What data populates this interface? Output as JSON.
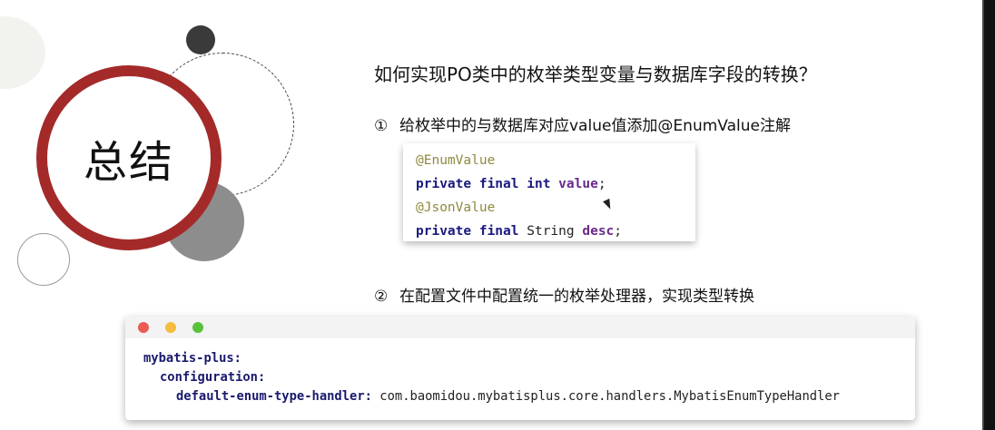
{
  "slide": {
    "ring_label": "总结",
    "title": "如何实现PO类中的枚举类型变量与数据库字段的转换？",
    "steps": [
      {
        "marker": "①",
        "text": "给枚举中的与数据库对应value值添加@EnumValue注解"
      },
      {
        "marker": "②",
        "text": "在配置文件中配置统一的枚举处理器，实现类型转换"
      }
    ],
    "java_code": {
      "line1_annotation": "@EnumValue",
      "line2": {
        "private": "private",
        "final": "final",
        "type": "int",
        "field": "value",
        "end": ";"
      },
      "line3_annotation": "@JsonValue",
      "line4": {
        "private": "private",
        "final": "final",
        "type": "String",
        "field": "desc",
        "end": ";"
      }
    },
    "yaml_code": {
      "key1": "mybatis-plus:",
      "key2": "configuration:",
      "key3": "default-enum-type-handler:",
      "value3": "com.baomidou.mybatisplus.core.handlers.MybatisEnumTypeHandler"
    },
    "colors": {
      "accent_red": "#a42a2a",
      "annotation": "#8f8a3e",
      "keyword": "#1a1a80",
      "field": "#6a2a8a"
    }
  }
}
